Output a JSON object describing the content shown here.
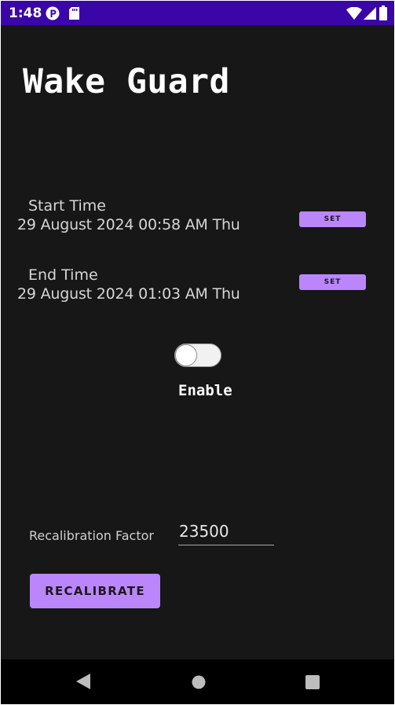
{
  "status_bar": {
    "time": "1:48",
    "color": "#3b06a8",
    "icons": [
      "app-notification-icon",
      "sd-card-icon",
      "wifi-icon",
      "signal-icon",
      "battery-icon"
    ]
  },
  "app": {
    "title": "Wake Guard"
  },
  "start_time": {
    "label": "Start Time",
    "value": "29 August 2024 00:58 AM Thu",
    "button_label": "SET"
  },
  "end_time": {
    "label": "End Time",
    "value": "29 August 2024 01:03 AM Thu",
    "button_label": "SET"
  },
  "enable_toggle": {
    "label": "Enable",
    "state": "off"
  },
  "recalibration": {
    "label": "Recalibration Factor",
    "value": "23500",
    "button_label": "RECALIBRATE"
  },
  "colors": {
    "background": "#171717",
    "accent": "#bb86fc",
    "nav_bar": "#000000"
  },
  "nav_bar": {
    "buttons": [
      "back-icon",
      "home-icon",
      "recents-icon"
    ]
  }
}
